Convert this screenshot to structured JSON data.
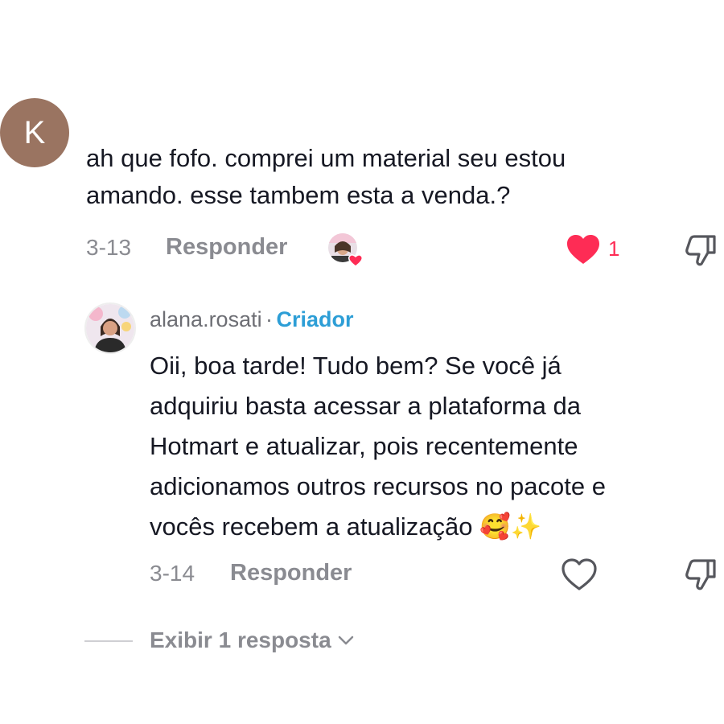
{
  "comment": {
    "avatar_letter": "K",
    "text_line1": "ah que fofo. comprei um material seu estou",
    "text_line2": "amando. esse tambem esta a venda.?",
    "date": "3-13",
    "reply_label": "Responder",
    "like_count": "1",
    "liked": true,
    "like_color": "#fe2c55"
  },
  "reply": {
    "username": "alana.rosati",
    "separator": "·",
    "badge": "Criador",
    "badge_color": "#2d9ed6",
    "text_lines": [
      "Oii, boa tarde! Tudo bem? Se você já",
      "adquiriu basta acessar a plataforma da",
      "Hotmart e atualizar, pois recentemente",
      "adicionamos outros recursos no pacote e",
      "vocês recebem a atualização"
    ],
    "emoji": "🥰✨",
    "date": "3-14",
    "reply_label": "Responder"
  },
  "view_replies": {
    "label": "Exibir 1 resposta"
  },
  "icons": {
    "like_filled": "heart-filled-icon",
    "like_outline": "heart-outline-icon",
    "dislike": "thumbs-down-icon",
    "chevron": "chevron-down-icon"
  }
}
